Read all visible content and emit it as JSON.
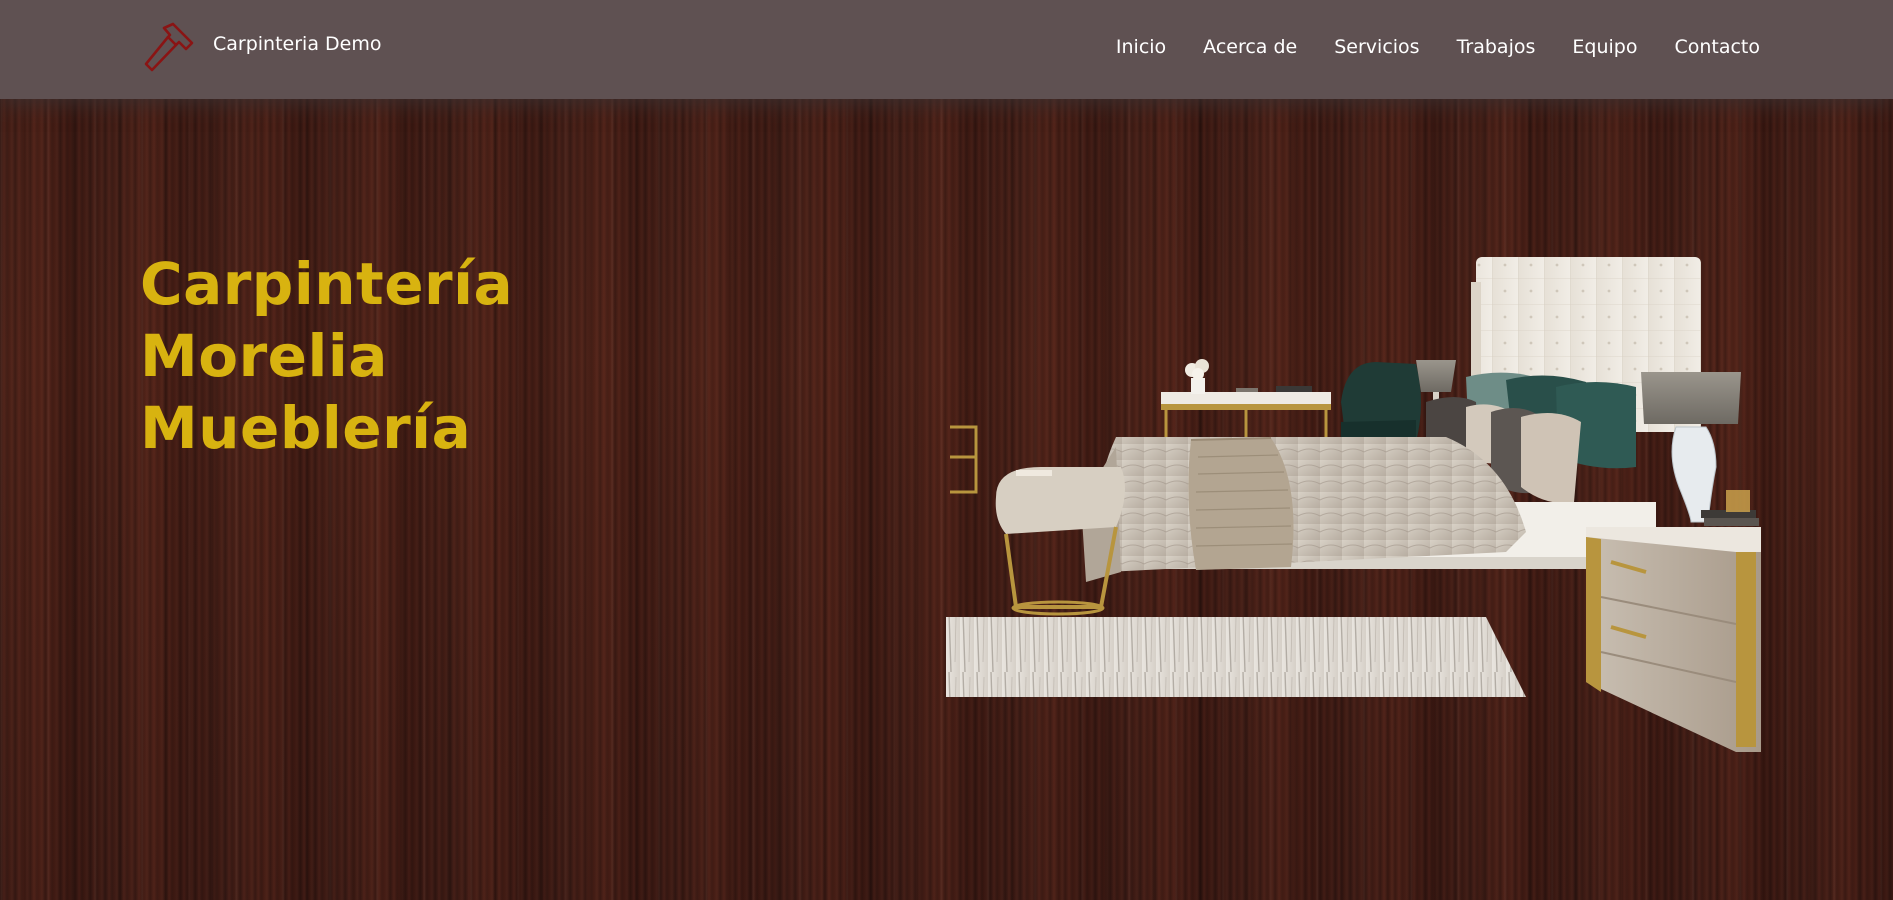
{
  "header": {
    "brand_name": "Carpinteria Demo",
    "brand_icon": "hammer-icon",
    "nav": [
      {
        "label": "Inicio"
      },
      {
        "label": "Acerca de"
      },
      {
        "label": "Servicios"
      },
      {
        "label": "Trabajos"
      },
      {
        "label": "Equipo"
      },
      {
        "label": "Contacto"
      }
    ]
  },
  "hero": {
    "title_lines": [
      "Carpintería",
      "Morelia",
      "Mueblería"
    ],
    "image": "bedroom-furniture-image"
  },
  "colors": {
    "navbar_bg": "#5f5152",
    "title_color": "#d8b310",
    "wood_bg": "#3d1d17",
    "brand_icon_color": "#8a1414"
  }
}
